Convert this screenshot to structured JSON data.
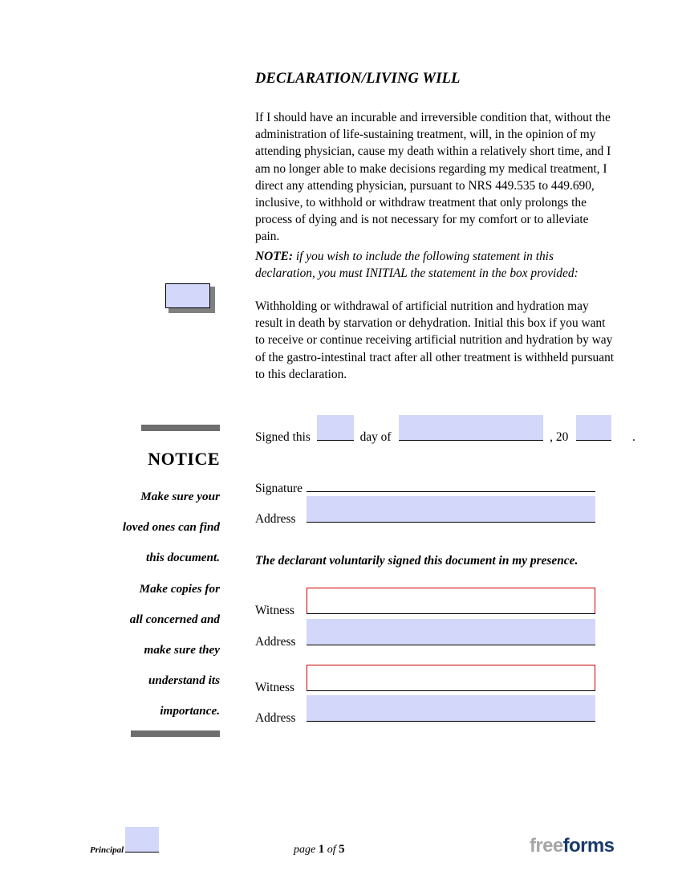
{
  "document": {
    "title": "DECLARATION/LIVING WILL",
    "body_paragraph": "If I should have an incurable and irreversible condition that, without the administration of life-sustaining treatment, will, in the opinion of my attending physician, cause my death within a relatively short time, and I am no longer able to make decisions regarding my medical treatment, I direct any attending physician, pursuant to NRS 449.535 to 449.690, inclusive, to withhold or withdraw treatment that only prolongs the process of dying and is not necessary for my comfort or to alleviate pain.",
    "note_label": "NOTE:",
    "note_text": "if you wish to include the following statement in this declaration, you must INITIAL the statement in the box provided:",
    "withholding_paragraph": "Withholding or withdrawal of artificial nutrition and hydration may result in death by starvation or dehydration. Initial this box if you want to receive or continue receiving artificial nutrition and hydration by way of the gastro-intestinal tract after all other treatment is withheld pursuant to this declaration."
  },
  "notice": {
    "heading": "NOTICE",
    "lines": [
      "Make sure your",
      "loved ones can find",
      "this document.",
      "Make copies for",
      "all concerned and",
      "make sure they",
      "understand its",
      "importance."
    ]
  },
  "signed_row": {
    "prefix": "Signed this",
    "day_value": "",
    "middle": "day of",
    "month_value": "",
    "year_prefix": ", 20",
    "year_value": "",
    "suffix": "."
  },
  "fields": {
    "signature_label": "Signature",
    "signature_value": "",
    "address_label": "Address",
    "address1_value": "",
    "witness_label": "Witness",
    "witness1_value": "",
    "address2_value": "",
    "witness2_value": "",
    "address3_value": ""
  },
  "declarant_statement": "The declarant voluntarily signed this document in my presence.",
  "footer": {
    "principal_label": "Principal",
    "principal_value": "",
    "page_word": "page",
    "page_current": "1",
    "page_of": "of",
    "page_total": "5",
    "logo_first": "free",
    "logo_second": "forms"
  },
  "colors": {
    "field_fill": "#d3d8fa",
    "required_border": "#cc0000",
    "divider_gray": "#6e6e6e",
    "logo_gray": "#a6a6a6",
    "logo_navy": "#1a3a6b"
  }
}
